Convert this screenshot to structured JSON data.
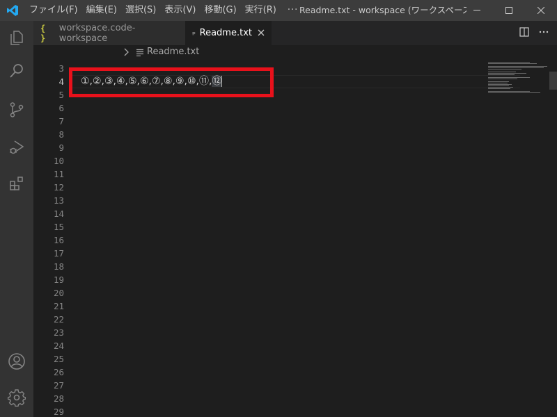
{
  "menu": {
    "items": [
      "ファイル(F)",
      "編集(E)",
      "選択(S)",
      "表示(V)",
      "移動(G)",
      "実行(R)"
    ],
    "more": "···"
  },
  "window": {
    "title": "Readme.txt - workspace (ワークスペース) - Vi..."
  },
  "tabs": [
    {
      "label": "workspace.code-workspace",
      "icon": "json-braces-icon",
      "active": false
    },
    {
      "label": "Readme.txt",
      "icon": "text-file-icon",
      "active": true
    }
  ],
  "breadcrumb": {
    "file": "Readme.txt"
  },
  "editor": {
    "line_numbers": [
      "3",
      "4",
      "5",
      "6",
      "7",
      "8",
      "9",
      "10",
      "11",
      "12",
      "13",
      "14",
      "15",
      "16",
      "17",
      "18",
      "19",
      "20",
      "21",
      "22",
      "23",
      "24",
      "25",
      "26",
      "27",
      "28",
      "29"
    ],
    "active_line": "4",
    "content_main": "①,②,③,④,⑤,⑥,⑦,⑧,⑨,⑩,⑪,",
    "content_selected": "⑫"
  },
  "colors": {
    "accent": "#007acc",
    "highlight_box": "#e8111b",
    "json_icon": "#cbcb41"
  }
}
